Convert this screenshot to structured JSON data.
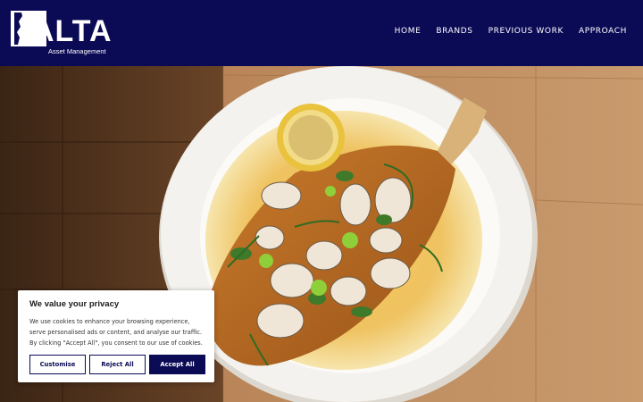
{
  "brand": {
    "logo_text": "ALTA",
    "tagline": "Asset Management"
  },
  "nav": {
    "items": [
      {
        "label": "HOME"
      },
      {
        "label": "BRANDS"
      },
      {
        "label": "PREVIOUS WORK"
      },
      {
        "label": "APPROACH"
      }
    ]
  },
  "hero": {
    "image": "plated-fish-with-clams-on-wooden-table"
  },
  "cookie_banner": {
    "title": "We value your privacy",
    "body": "We use cookies to enhance your browsing experience, serve personalised ads or content, and analyse our traffic. By clicking \"Accept All\", you consent to our use of cookies.",
    "customise_label": "Customise",
    "reject_label": "Reject All",
    "accept_label": "Accept All"
  },
  "colors": {
    "header_bg": "#0b0a55",
    "accent": "#0b0a55",
    "wood": "#b07a4e",
    "plate": "#f3f1ec"
  }
}
